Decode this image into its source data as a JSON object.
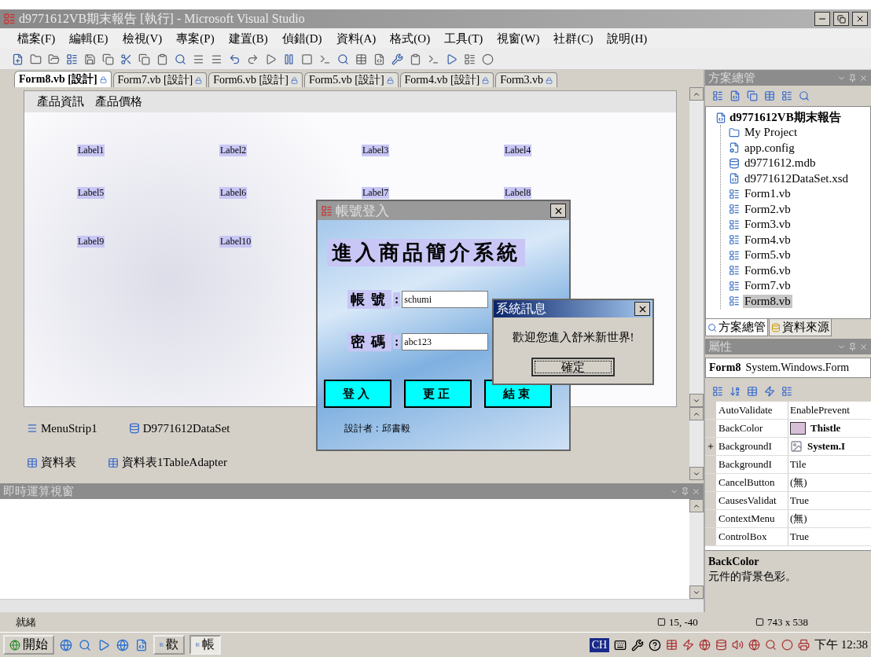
{
  "window": {
    "title": "d9771612VB期末報告 [執行] - Microsoft Visual Studio"
  },
  "menu": [
    "檔案(F)",
    "編輯(E)",
    "檢視(V)",
    "專案(P)",
    "建置(B)",
    "偵錯(D)",
    "資料(A)",
    "格式(O)",
    "工具(T)",
    "視窗(W)",
    "社群(C)",
    "說明(H)"
  ],
  "tabs": [
    {
      "label": "Form8.vb [設計]",
      "selected": true
    },
    {
      "label": "Form7.vb [設計]",
      "selected": false
    },
    {
      "label": "Form6.vb [設計]",
      "selected": false
    },
    {
      "label": "Form5.vb [設計]",
      "selected": false
    },
    {
      "label": "Form4.vb [設計]",
      "selected": false
    },
    {
      "label": "Form3.vb",
      "selected": false
    }
  ],
  "designer": {
    "form_menu": [
      "產品資訊",
      "產品價格"
    ],
    "labels": [
      "Label1",
      "Label2",
      "Label3",
      "Label4",
      "Label5",
      "Label6",
      "Label7",
      "Label8",
      "Label9",
      "Label10"
    ]
  },
  "component_tray": [
    {
      "label": "MenuStrip1",
      "kind": "menu"
    },
    {
      "label": "D9771612DataSet",
      "kind": "dataset"
    },
    {
      "label": "資料表",
      "kind": "binding"
    },
    {
      "label": "資料表1TableAdapter",
      "kind": "adapter"
    }
  ],
  "login_dialog": {
    "title": "帳號登入",
    "heading": "進入商品簡介系統",
    "fields": [
      {
        "label": "帳號",
        "separator": ":",
        "value": "schumi"
      },
      {
        "label": "密碼",
        "separator": ":",
        "value": "abc123"
      }
    ],
    "buttons": [
      "登入",
      "更正",
      "結束"
    ],
    "footer": "設計者 : 邱書毅"
  },
  "message_box": {
    "title": "系統訊息",
    "message": "歡迎您進入舒米新世界!",
    "button": "確定"
  },
  "immediate_window": {
    "title": "即時運算視窗"
  },
  "solution_explorer": {
    "title": "方案總管",
    "project": {
      "label": "d9771612VB期末報告",
      "children": [
        {
          "label": "My Project",
          "kind": "project",
          "selected": false
        },
        {
          "label": "app.config",
          "kind": "config",
          "selected": false
        },
        {
          "label": "d9771612.mdb",
          "kind": "database",
          "selected": false
        },
        {
          "label": "d9771612DataSet.xsd",
          "kind": "xsd",
          "selected": false
        },
        {
          "label": "Form1.vb",
          "kind": "form",
          "selected": false
        },
        {
          "label": "Form2.vb",
          "kind": "form",
          "selected": false
        },
        {
          "label": "Form3.vb",
          "kind": "form",
          "selected": false
        },
        {
          "label": "Form4.vb",
          "kind": "form",
          "selected": false
        },
        {
          "label": "Form5.vb",
          "kind": "form",
          "selected": false
        },
        {
          "label": "Form6.vb",
          "kind": "form",
          "selected": false
        },
        {
          "label": "Form7.vb",
          "kind": "form",
          "selected": false
        },
        {
          "label": "Form8.vb",
          "kind": "form",
          "selected": true
        }
      ]
    },
    "tabs": [
      {
        "label": "方案總管",
        "selected": true
      },
      {
        "label": "資料來源",
        "selected": false
      }
    ]
  },
  "properties": {
    "title": "屬性",
    "object": "Form8",
    "type": "System.Windows.Form",
    "rows": [
      {
        "name": "AutoValidate",
        "value": "EnablePrevent",
        "kind": "text",
        "modified": false,
        "expandable": false
      },
      {
        "name": "BackColor",
        "value": "Thistle",
        "kind": "color",
        "color": "#d8bfd8",
        "modified": true,
        "expandable": false
      },
      {
        "name": "BackgroundI",
        "value": "System.I",
        "kind": "image",
        "modified": true,
        "expandable": true
      },
      {
        "name": "BackgroundI",
        "value": "Tile",
        "kind": "text",
        "modified": false,
        "expandable": false
      },
      {
        "name": "CancelButton",
        "value": "(無)",
        "kind": "text",
        "modified": false,
        "expandable": false
      },
      {
        "name": "CausesValidat",
        "value": "True",
        "kind": "text",
        "modified": false,
        "expandable": false
      },
      {
        "name": "ContextMenu",
        "value": "(無)",
        "kind": "text",
        "modified": false,
        "expandable": false
      },
      {
        "name": "ControlBox",
        "value": "True",
        "kind": "text",
        "modified": false,
        "expandable": false
      }
    ],
    "description_title": "BackColor",
    "description": "元件的背景色彩。"
  },
  "status_bar": {
    "text": "就緒",
    "position": "15, -40",
    "size": "743 x 538"
  },
  "taskbar": {
    "start": "開始",
    "tasks": [
      {
        "label": "歡",
        "selected": false
      },
      {
        "label": "帳",
        "selected": true
      }
    ],
    "input_method": "CH",
    "clock": "下午 12:38"
  }
}
